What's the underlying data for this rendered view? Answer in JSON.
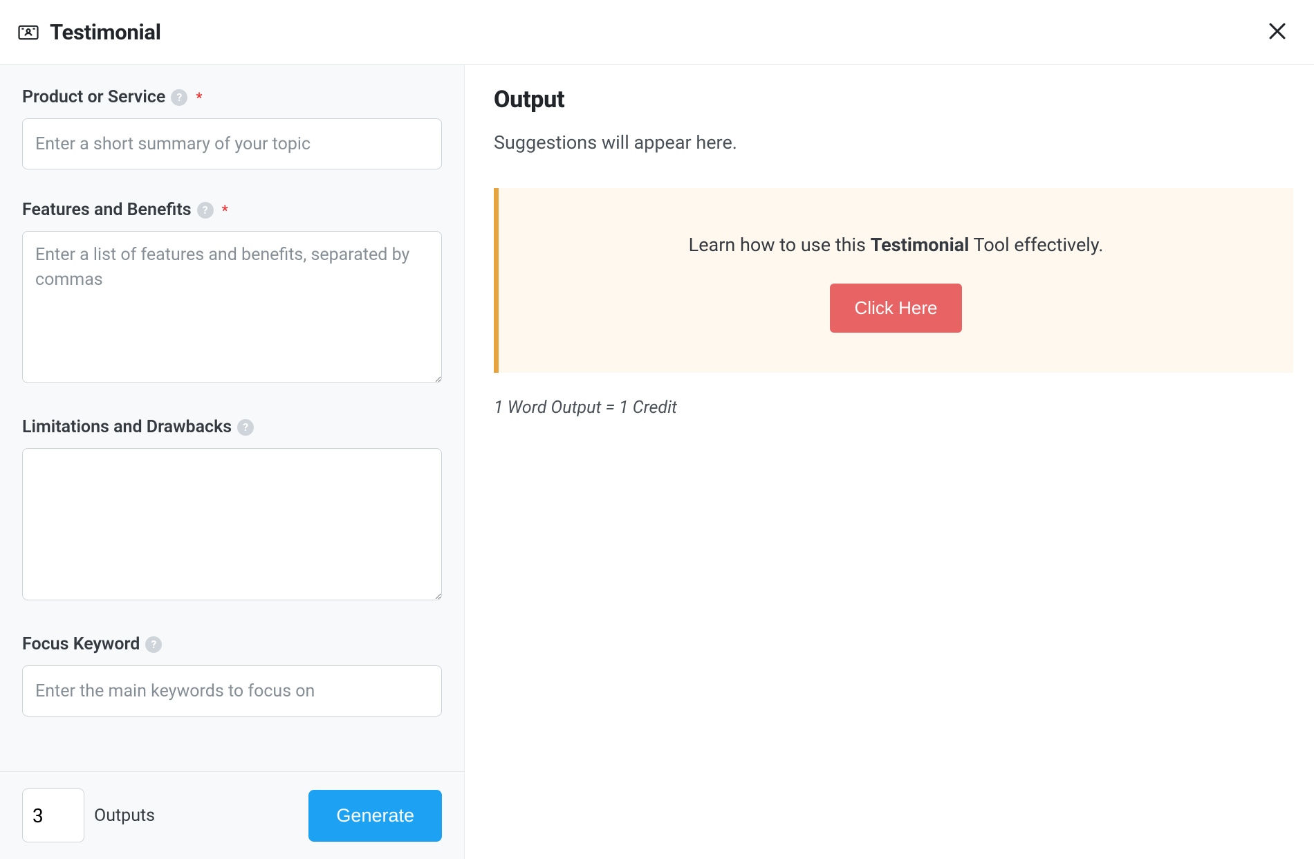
{
  "header": {
    "title": "Testimonial"
  },
  "form": {
    "product": {
      "label": "Product or Service",
      "required": true,
      "placeholder": "Enter a short summary of your topic",
      "value": ""
    },
    "features": {
      "label": "Features and Benefits",
      "required": true,
      "placeholder": "Enter a list of features and benefits, separated by commas",
      "value": ""
    },
    "limitations": {
      "label": "Limitations and Drawbacks",
      "required": false,
      "placeholder": "",
      "value": ""
    },
    "keyword": {
      "label": "Focus Keyword",
      "required": false,
      "placeholder": "Enter the main keywords to focus on",
      "value": ""
    }
  },
  "footer": {
    "outputs_value": "3",
    "outputs_label": "Outputs",
    "generate_label": "Generate"
  },
  "output": {
    "title": "Output",
    "subtitle": "Suggestions will appear here.",
    "callout_prefix": "Learn how to use this ",
    "callout_strong": "Testimonial",
    "callout_suffix": " Tool effectively.",
    "callout_button": "Click Here",
    "credit_note": "1 Word Output = 1 Credit"
  }
}
